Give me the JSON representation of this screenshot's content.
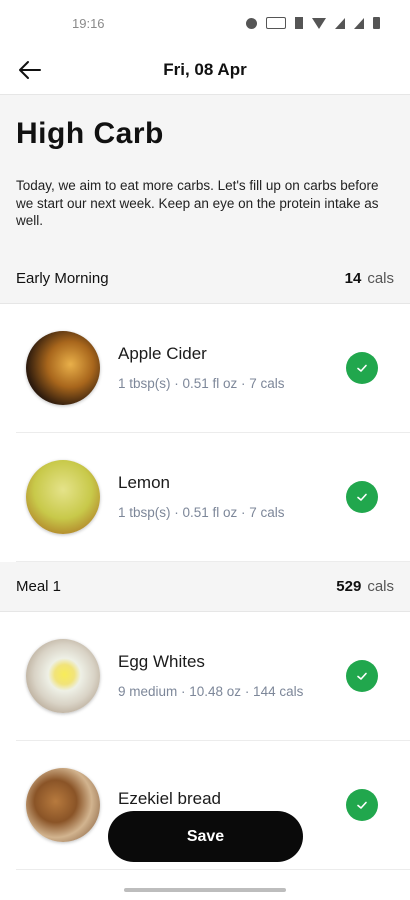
{
  "status_bar": {
    "time": "19:16"
  },
  "header": {
    "date": "Fri, 08 Apr"
  },
  "hero": {
    "title": "High Carb",
    "description": "Today, we aim to eat more carbs. Let's fill up on carbs before we start our next week. Keep an eye on the protein intake as well."
  },
  "sections": [
    {
      "title": "Early Morning",
      "cals_value": "14",
      "cals_unit": "cals",
      "items": [
        {
          "name": "Apple Cider",
          "detail": "1 tbsp(s) · 0.51 fl oz · 7 cals"
        },
        {
          "name": "Lemon",
          "detail": "1 tbsp(s) · 0.51 fl oz · 7 cals"
        }
      ]
    },
    {
      "title": "Meal 1",
      "cals_value": "529",
      "cals_unit": "cals",
      "items": [
        {
          "name": "Egg Whites",
          "detail": "9 medium · 10.48 oz · 144 cals"
        },
        {
          "name": "Ezekiel bread",
          "detail": ""
        }
      ]
    }
  ],
  "save_label": "Save",
  "colors": {
    "accent_check": "#21a74d",
    "save_button": "#0a0a0a"
  }
}
